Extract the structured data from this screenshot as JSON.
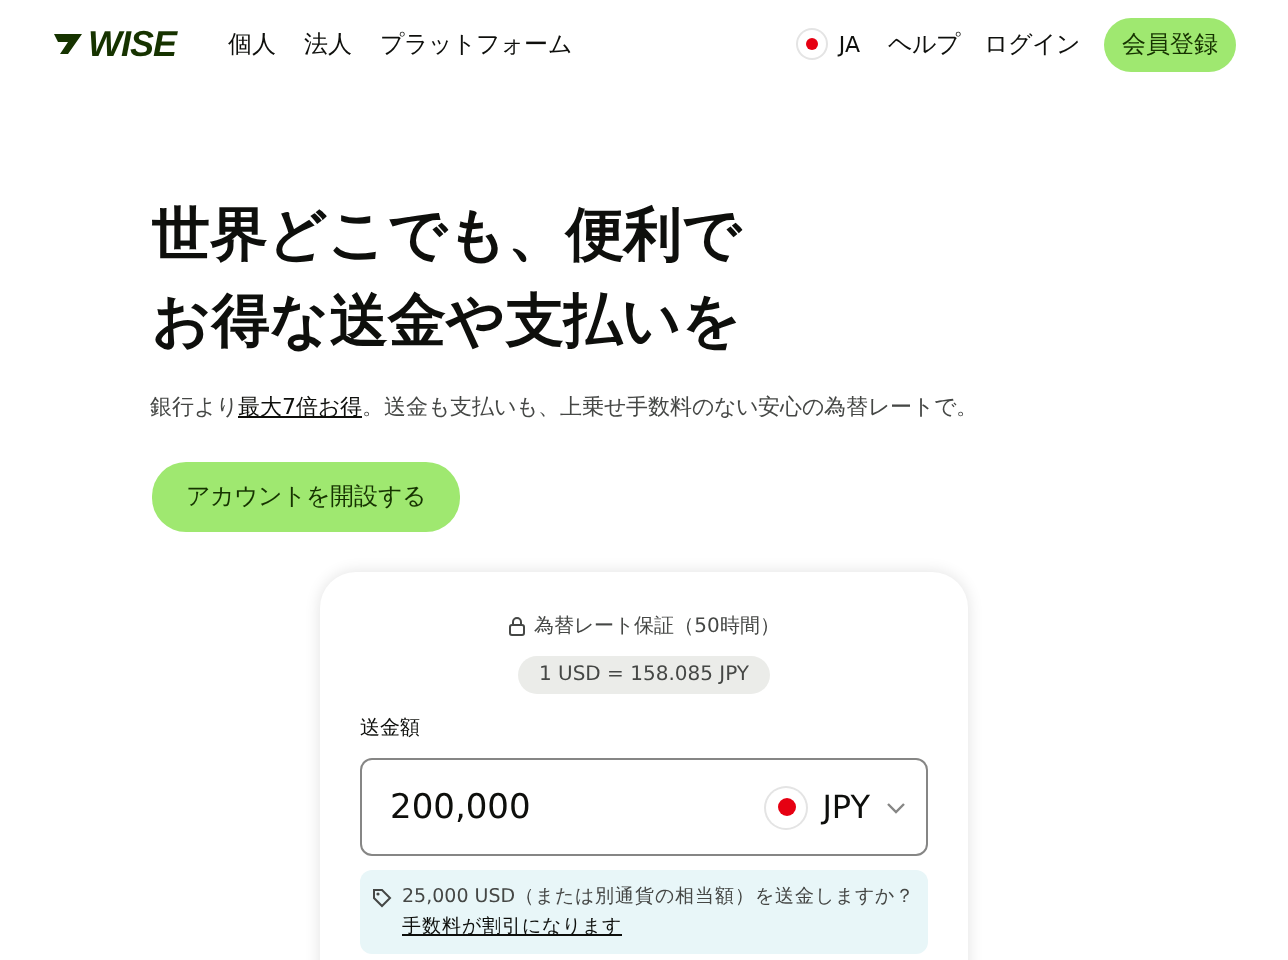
{
  "header": {
    "logo": "WISE",
    "nav": [
      "個人",
      "法人",
      "プラットフォーム"
    ],
    "language": "JA",
    "links": [
      "ヘルプ",
      "ログイン"
    ],
    "signup": "会員登録"
  },
  "hero": {
    "title_lines": [
      "世界どこでも、便利で",
      "お得な送金や支払いを"
    ],
    "subtitle_before": "銀行より",
    "subtitle_link": "最大7倍お得",
    "subtitle_after": "。送金も支払いも、上乗せ手数料のない安心の為替レートで。",
    "cta": "アカウントを開設する"
  },
  "calculator": {
    "guarantee": "為替レート保証（50時間）",
    "rate": "1 USD = 158.085 JPY",
    "amount_label": "送金額",
    "amount": "200,000",
    "currency": "JPY",
    "notice": "25,000 USD（または別通貨の相当額）を送金しますか？",
    "notice_link": "手数料が割引になります"
  }
}
